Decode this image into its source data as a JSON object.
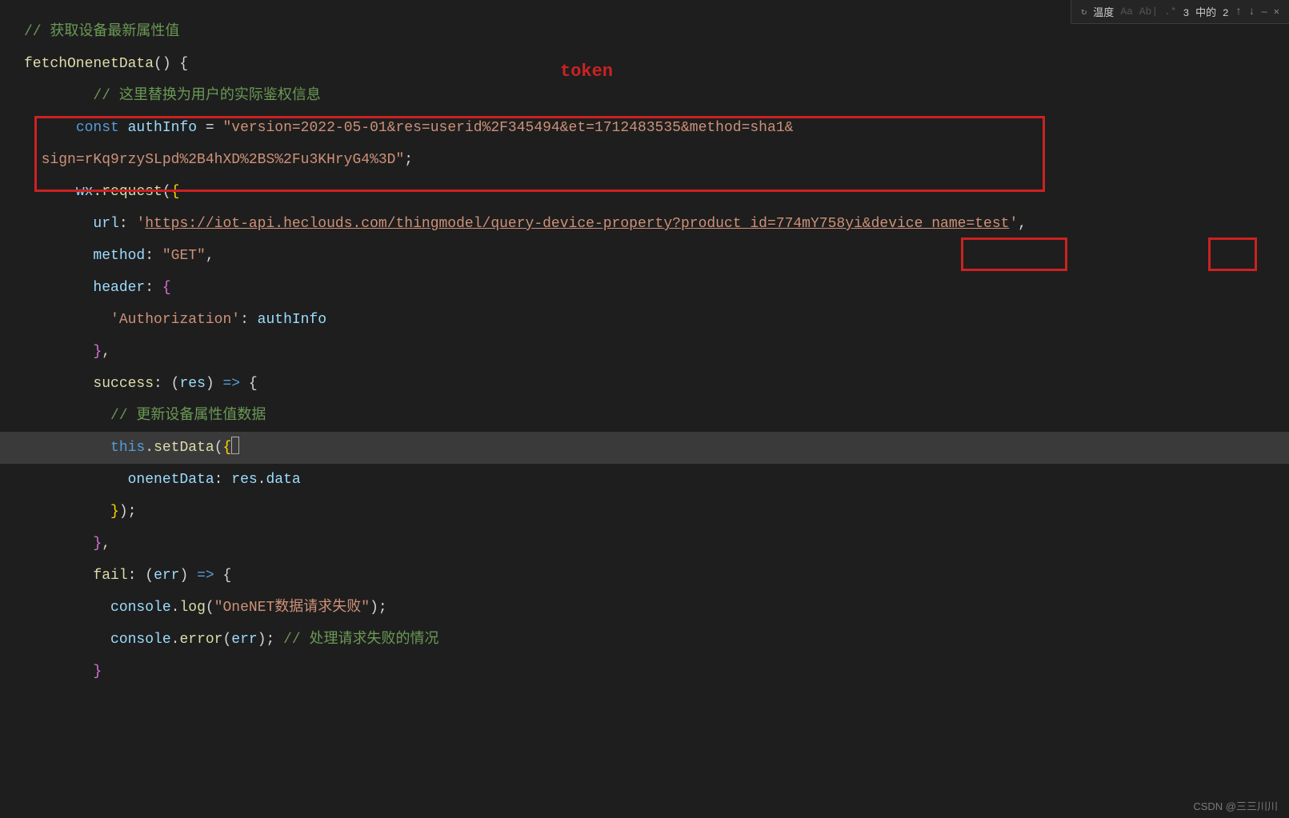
{
  "findbar": {
    "icon_replace": "↻",
    "term": "温度",
    "opts": "Aa Ab| .*",
    "count": "3 中的 2",
    "arrow_up": "↑",
    "arrow_down": "↓",
    "min": "—",
    "close": "✕"
  },
  "annotations": {
    "token_label": "token"
  },
  "code": {
    "l1_comment": "// 获取设备最新属性值",
    "l2_fn": "fetchOnenetData",
    "l2_rest": "() {",
    "l3_indent": "        ",
    "l3_comment": "// 这里替换为用户的实际鉴权信息",
    "l4_indent": "      ",
    "l4_kw": "const",
    "l4_var": " authInfo ",
    "l4_eq": "= ",
    "l4_str": "\"version=2022-05-01&res=userid%2F345494&et=1712483535&method=sha1&",
    "l5_indent": "  ",
    "l5_str": "sign=rKq9rzySLpd%2B4hXD%2BS%2Fu3KHryG4%3D\"",
    "l5_semi": ";",
    "l6_indent": "      ",
    "l6_obj": "wx",
    "l6_dot": ".",
    "l6_fn": "request",
    "l6_rest1": "(",
    "l6_brace": "{",
    "l7_indent": "        ",
    "l7_key": "url",
    "l7_colon": ": ",
    "l7_q1": "'",
    "l7_url": "https://iot-api.heclouds.com/thingmodel/query-device-property?product_id=774mY758yi&device_name=test",
    "l7_q2": "'",
    "l7_comma": ",",
    "l8_indent": "        ",
    "l8_key": "method",
    "l8_colon": ": ",
    "l8_str": "\"GET\"",
    "l8_comma": ",",
    "l9_indent": "        ",
    "l9_key": "header",
    "l9_colon": ": ",
    "l9_brace": "{",
    "l10_indent": "          ",
    "l10_str": "'Authorization'",
    "l10_colon": ": ",
    "l10_var": "authInfo",
    "l11_indent": "        ",
    "l11_brace": "}",
    "l11_comma": ",",
    "l12_indent": "        ",
    "l12_key": "success",
    "l12_colon": ": ",
    "l12_param_open": "(",
    "l12_param": "res",
    "l12_param_close": ") ",
    "l12_arrow": "=>",
    "l12_brace_open": " {",
    "l13_indent": "          ",
    "l13_comment": "// 更新设备属性值数据",
    "l14_indent": "          ",
    "l14_this": "this",
    "l14_dot": ".",
    "l14_fn": "setData",
    "l14_open": "(",
    "l14_brace": "{",
    "l15_indent": "            ",
    "l15_key": "onenetData",
    "l15_colon": ": ",
    "l15_res": "res",
    "l15_dot": ".",
    "l15_data": "data",
    "l16_indent": "          ",
    "l16_brace": "}",
    "l16_close": ");",
    "l17_indent": "        ",
    "l17_brace": "}",
    "l17_comma": ",",
    "l18_indent": "        ",
    "l18_key": "fail",
    "l18_colon": ": ",
    "l18_open": "(",
    "l18_param": "err",
    "l18_close": ") ",
    "l18_arrow": "=>",
    "l18_brace": " {",
    "l19_indent": "          ",
    "l19_console": "console",
    "l19_dot": ".",
    "l19_fn": "log",
    "l19_open": "(",
    "l19_str": "\"OneNET数据请求失败\"",
    "l19_close": ");",
    "l20_indent": "          ",
    "l20_console": "console",
    "l20_dot": ".",
    "l20_fn": "error",
    "l20_open": "(",
    "l20_arg": "err",
    "l20_close": "); ",
    "l20_comment": "// 处理请求失败的情况",
    "l21_indent": "        ",
    "l21_brace": "}"
  },
  "watermark": "CSDN @三三川川"
}
